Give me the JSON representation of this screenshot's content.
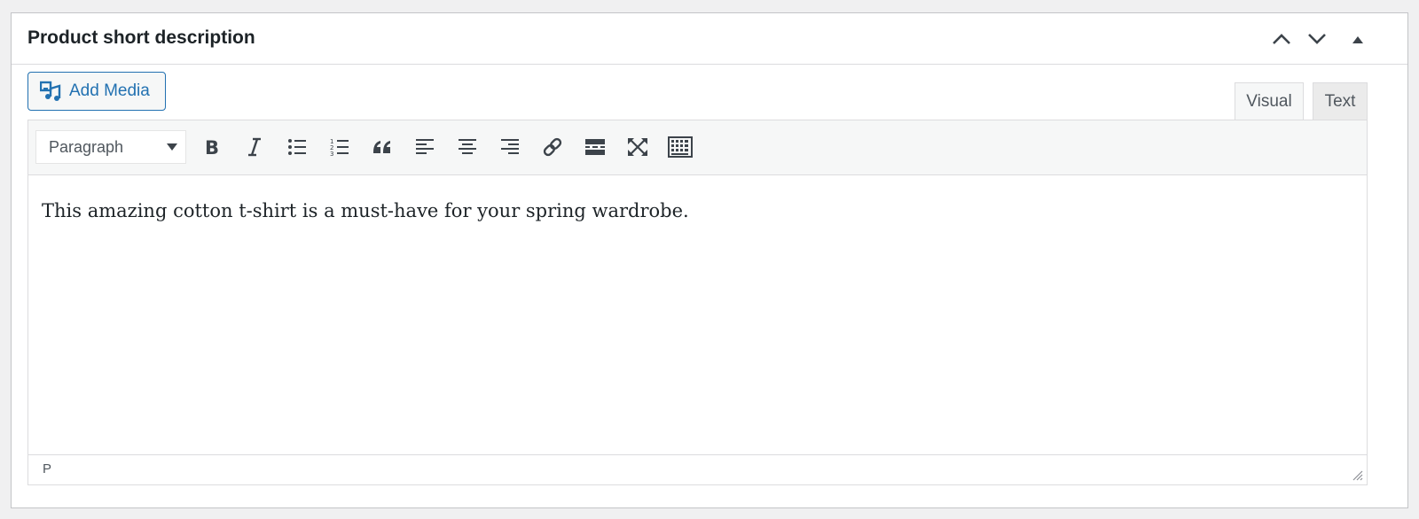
{
  "metabox": {
    "title": "Product short description",
    "header_icons": [
      "chevron-up-icon",
      "chevron-down-icon",
      "triangle-up-icon"
    ]
  },
  "media": {
    "add_media_label": "Add Media",
    "icon": "add-media-icon"
  },
  "tabs": {
    "visual": "Visual",
    "text": "Text"
  },
  "toolbar": {
    "format_selected": "Paragraph",
    "buttons": [
      "bold-icon",
      "italic-icon",
      "bulleted-list-icon",
      "numbered-list-icon",
      "blockquote-icon",
      "align-left-icon",
      "align-center-icon",
      "align-right-icon",
      "link-icon",
      "read-more-icon",
      "fullscreen-icon",
      "toolbar-toggle-icon"
    ]
  },
  "editor": {
    "content": "This amazing cotton t-shirt is a must-have for your spring wardrobe.",
    "status_path": "P"
  },
  "colors": {
    "accent": "#2271b1",
    "border": "#dcdcde",
    "text": "#1d2327",
    "toolbar_bg": "#f6f7f7"
  }
}
